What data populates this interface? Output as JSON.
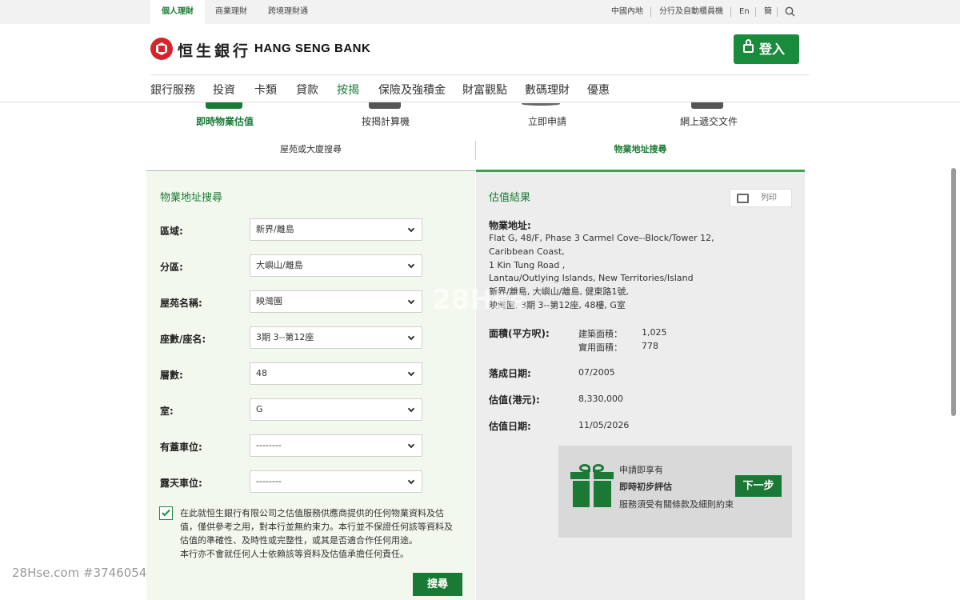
{
  "topbar": {
    "segments": [
      "個人理財",
      "商業理財",
      "跨境理財通"
    ],
    "right_links": [
      "中國內地",
      "分行及自動櫃員機",
      "En",
      "簡"
    ]
  },
  "header": {
    "logo_cn": "恒生銀行",
    "logo_en": "HANG SENG BANK",
    "login_label": "登入"
  },
  "main_nav": [
    "銀行服務",
    "投資",
    "卡類",
    "貸款",
    "按揭",
    "保險及強積金",
    "財富觀點",
    "數碼理財",
    "優惠"
  ],
  "quick_links": [
    "即時物業估值",
    "按揭計算機",
    "立即申請",
    "網上遞交文件"
  ],
  "tabs": [
    "屋苑或大廈搜尋",
    "物業地址搜尋"
  ],
  "search_form": {
    "title": "物業地址搜尋",
    "fields": [
      {
        "label": "區域:",
        "value": "新界/離島"
      },
      {
        "label": "分區:",
        "value": "大嶼山/離島"
      },
      {
        "label": "屋苑名稱:",
        "value": "映灣園"
      },
      {
        "label": "座數/座名:",
        "value": "3期 3--第12座"
      },
      {
        "label": "層數:",
        "value": "48"
      },
      {
        "label": "室:",
        "value": "G"
      },
      {
        "label": "有蓋車位:",
        "value": "--------"
      },
      {
        "label": "露天車位:",
        "value": "--------"
      }
    ],
    "disclaimer_lines": [
      "在此就恒生銀行有限公司之估值服務供應商提供的任何物業資料及估",
      "值，僅供參考之用，對本行並無約束力。本行並不保證任何該等資料及",
      "估值的準確性、及時性或完整性，或其是否適合作任何用途。",
      "本行亦不會就任何人士依賴該等資料及估值承擔任何責任。"
    ],
    "search_label": "搜尋"
  },
  "result": {
    "title": "估值結果",
    "print_label": "列印",
    "address_label": "物業地址:",
    "address_lines": [
      "Flat G, 48/F, Phase 3 Carmel Cove--Block/Tower 12,",
      "Caribbean Coast,",
      "1 Kin Tung Road ,",
      "Lantau/Outlying Islands, New Territories/Island",
      "新界/離島, 大嶼山/離島, 健東路1號,",
      "映灣園, 3期 3--第12座, 48樓, G室"
    ],
    "area_label": "面積(平方呎):",
    "gross_label": "建築面積：",
    "gross_value": "1,025",
    "saleable_label": "實用面積：",
    "saleable_value": "778",
    "completion_label": "落成日期:",
    "completion_value": "07/2005",
    "valuation_label": "估值(港元):",
    "valuation_value": "8,330,000",
    "valuation_date_label": "估值日期:",
    "valuation_date_value": "11/05/2026"
  },
  "promo": {
    "line1": "申請即享有",
    "line2": "即時初步評估",
    "line3": "服務須受有關條款及細則約束",
    "next_label": "下一步"
  },
  "watermark": "28Hse.com #3746054",
  "watermark_center": "28Hse"
}
